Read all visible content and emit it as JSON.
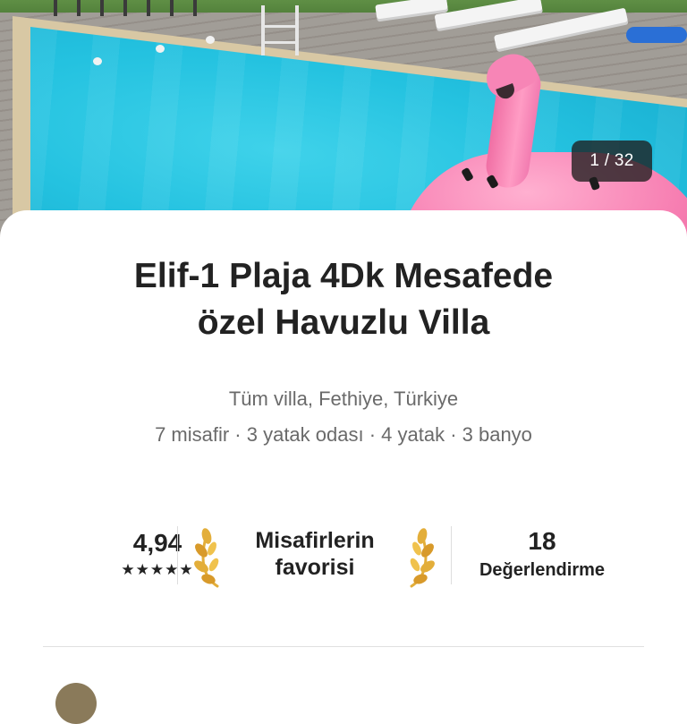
{
  "gallery": {
    "image_alt": "Villa swimming pool with pink flamingo float",
    "counter": "1 / 32"
  },
  "listing": {
    "title": "Elif-1 Plaja 4Dk Mesafede\nözel Havuzlu Villa",
    "location": "Tüm villa, Fethiye, Türkiye",
    "specs": "7 misafir · 3 yatak odası · 4 yatak · 3 banyo"
  },
  "stats": {
    "rating": "4,94",
    "stars": "★★★★★",
    "favorite_badge": "Misafirlerin\nfavorisi",
    "review_count": "18",
    "review_label": "Değerlendirme"
  },
  "colors": {
    "text": "#222222",
    "muted": "#6a6a6a",
    "laurel_gold": "#e3ae3a",
    "divider": "#dddddd"
  }
}
